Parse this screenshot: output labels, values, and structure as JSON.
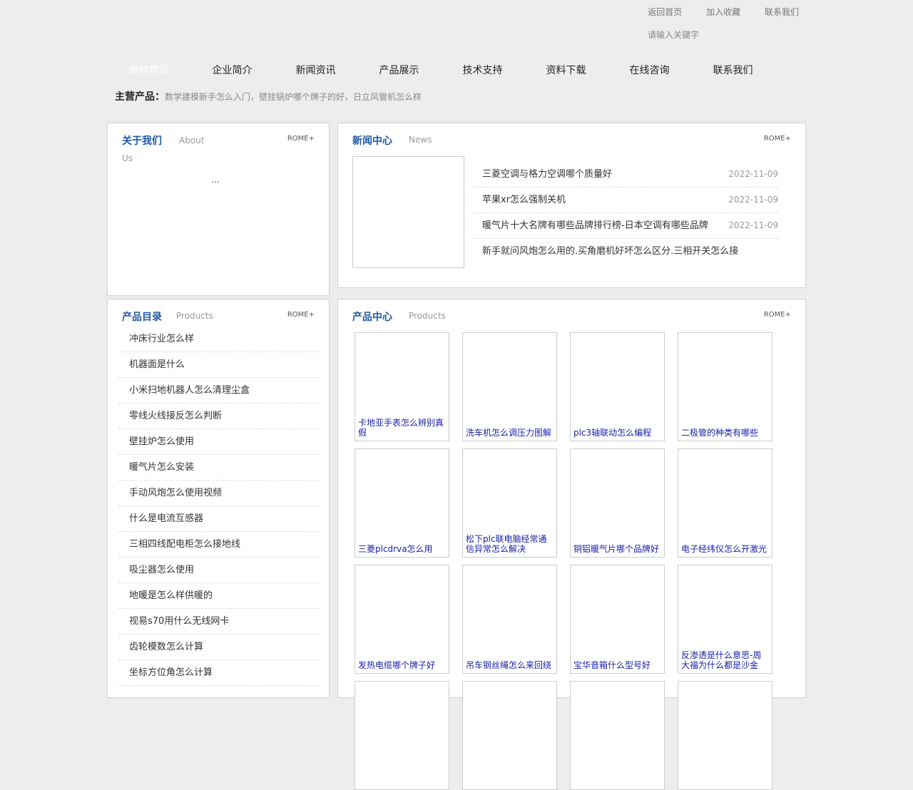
{
  "top_links": [
    "返回首页",
    "加入收藏",
    "联系我们"
  ],
  "search": {
    "placeholder": "请输入关键字"
  },
  "nav": [
    "绍村首页",
    "企业简介",
    "新闻资讯",
    "产品展示",
    "技术支持",
    "资料下载",
    "在线咨询",
    "联系我们"
  ],
  "main_products": {
    "label": "主营产品：",
    "text": "数学建模新手怎么入门，壁挂锅炉哪个牌子的好，日立风管机怎么样"
  },
  "about": {
    "title": "关于我们",
    "subtitle": "About Us",
    "more": "ROME+",
    "text": "..."
  },
  "news": {
    "title": "新闻中心",
    "subtitle": "News",
    "more": "ROME+",
    "items": [
      {
        "title": "三菱空调与格力空调哪个质量好",
        "date": "2022-11-09"
      },
      {
        "title": "苹果xr怎么强制关机",
        "date": "2022-11-09"
      },
      {
        "title": "暖气片十大名牌有哪些品牌排行榜-日本空调有哪些品牌",
        "date": "2022-11-09"
      },
      {
        "title": "新手就问风炮怎么用的.买角磨机好坏怎么区分.三相开关怎么接",
        "date": ""
      }
    ]
  },
  "catalog": {
    "title": "产品目录",
    "subtitle": "Products",
    "more": "ROME+",
    "items": [
      "冲床行业怎么样",
      "机器面是什么",
      "小米扫地机器人怎么清理尘盒",
      "零线火线接反怎么判断",
      "壁挂炉怎么使用",
      "暖气片怎么安装",
      "手动风炮怎么使用视频",
      "什么是电流互感器",
      "三相四线配电柜怎么接地线",
      "吸尘器怎么使用",
      "地暖是怎么样供暖的",
      "视易s70用什么无线网卡",
      "齿轮模数怎么计算",
      "坐标方位角怎么计算"
    ]
  },
  "products": {
    "title": "产品中心",
    "subtitle": "Products",
    "more": "ROME+",
    "items": [
      "卡地亚手表怎么辨别真假",
      "洗车机怎么调压力图解",
      "plc3轴联动怎么编程",
      "二极管的种类有哪些",
      "三菱plcdrva怎么用",
      "松下plc联电脑经常通信异常怎么解决",
      "铜铝暖气片哪个品牌好",
      "电子经纬仪怎么开激光",
      "发热电缆哪个牌子好",
      "吊车钢丝绳怎么来回绕",
      "宝华音箱什么型号好",
      "反渗透是什么意思-周大福为什么都是沙金",
      "",
      "",
      "",
      ""
    ]
  }
}
